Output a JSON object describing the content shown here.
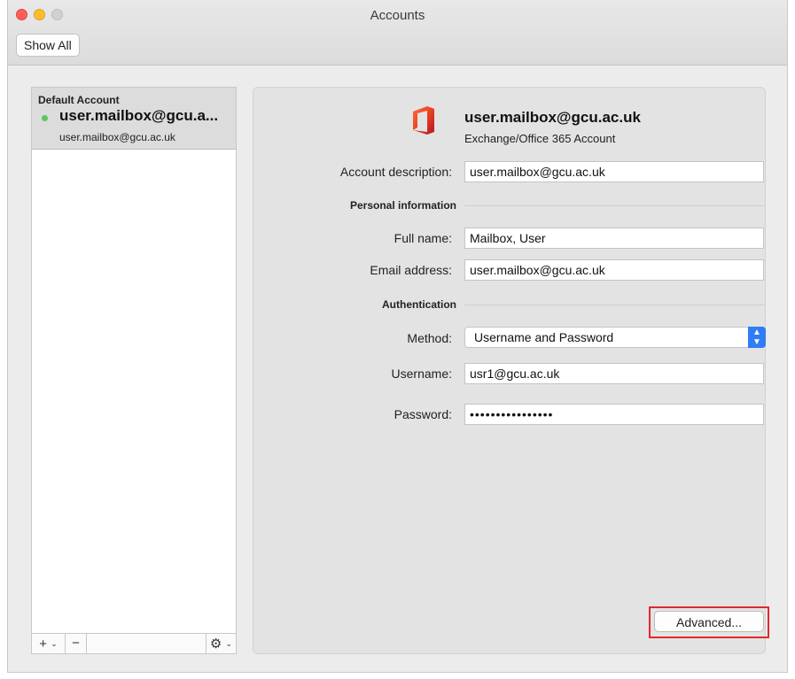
{
  "window": {
    "title": "Accounts",
    "show_all_label": "Show All"
  },
  "sidebar": {
    "group_label": "Default Account",
    "account": {
      "title": "user.mailbox@gcu.a...",
      "subtitle": "user.mailbox@gcu.ac.uk",
      "status_color": "#5ac85a"
    },
    "buttons": {
      "add": "+",
      "remove": "−",
      "gear": "⚙",
      "chevron": "⌄"
    }
  },
  "account_header": {
    "title": "user.mailbox@gcu.ac.uk",
    "subtitle": "Exchange/Office 365 Account",
    "icon": "office-icon"
  },
  "form": {
    "account_description": {
      "label": "Account description:",
      "value": "user.mailbox@gcu.ac.uk"
    },
    "personal_section": "Personal information",
    "full_name": {
      "label": "Full name:",
      "value": "Mailbox, User"
    },
    "email_address": {
      "label": "Email address:",
      "value": "user.mailbox@gcu.ac.uk"
    },
    "auth_section": "Authentication",
    "method": {
      "label": "Method:",
      "value": "Username and Password"
    },
    "username": {
      "label": "Username:",
      "value": "usr1@gcu.ac.uk"
    },
    "password": {
      "label": "Password:",
      "value": "••••••••••••••••"
    }
  },
  "advanced_label": "Advanced...",
  "colors": {
    "accent": "#2f7cf6",
    "highlight": "#e0292e",
    "office_red": "#d83b01"
  }
}
